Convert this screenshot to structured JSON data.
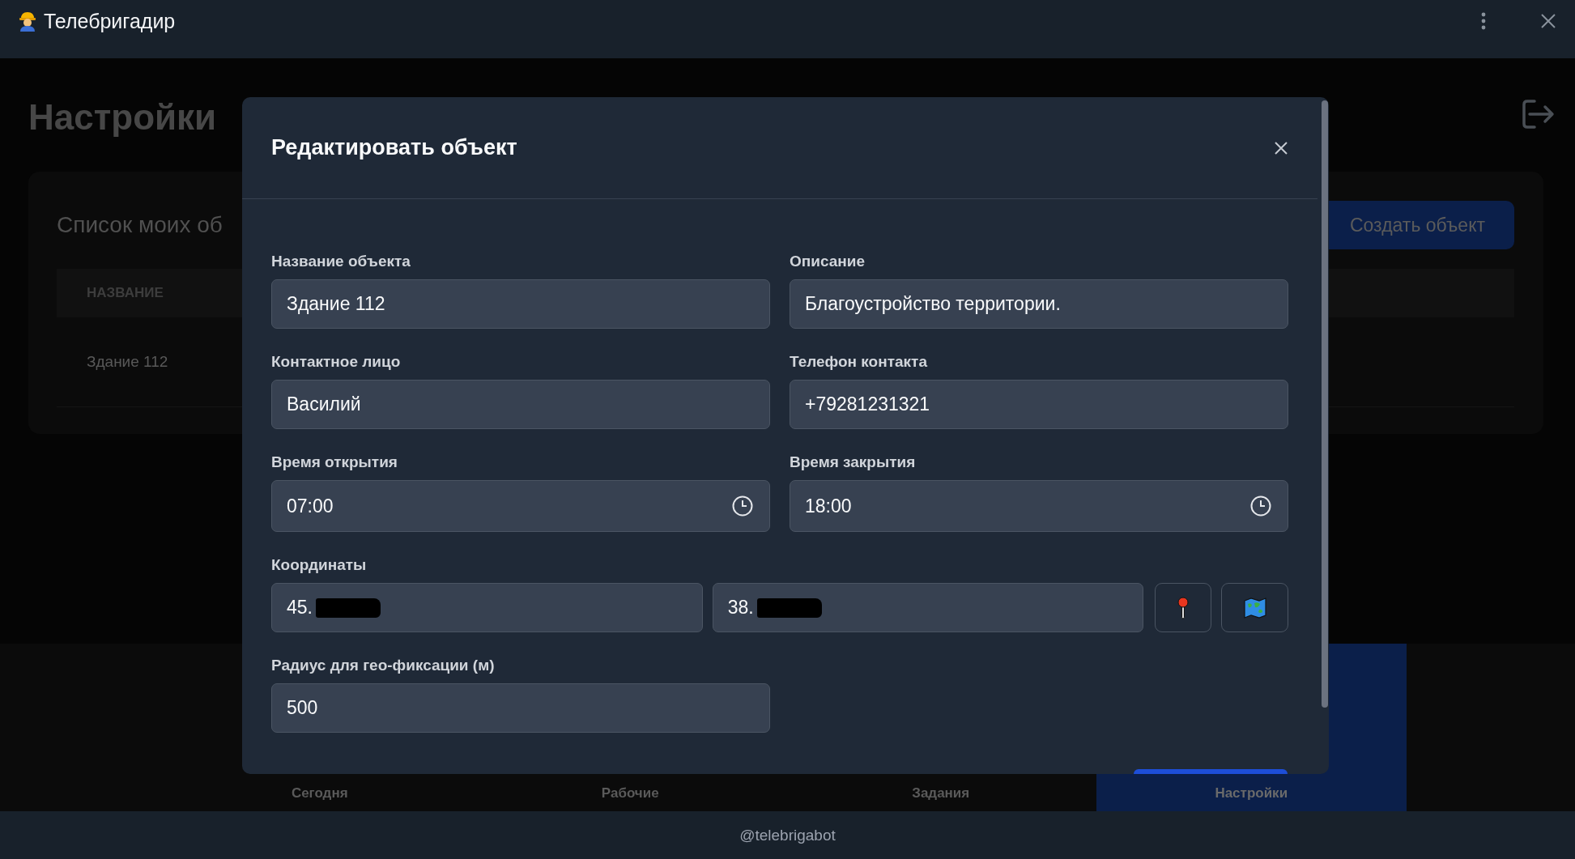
{
  "app_bar": {
    "title": "Телебригадир"
  },
  "page": {
    "title": "Настройки",
    "card": {
      "title": "Список моих об",
      "create_button": "Создать объект",
      "columns": [
        "НАЗВАНИЕ"
      ],
      "rows": [
        [
          "Здание 112"
        ]
      ]
    }
  },
  "bottom_nav": [
    {
      "label": "Сегодня",
      "selected": false
    },
    {
      "label": "Рабочие",
      "selected": false
    },
    {
      "label": "Задания",
      "selected": false
    },
    {
      "label": "Настройки",
      "selected": true
    }
  ],
  "modal": {
    "title": "Редактировать объект",
    "fields": [
      {
        "kind": "text",
        "label": "Название объекта",
        "value": "Здание 112"
      },
      {
        "kind": "text",
        "label": "Описание",
        "value": "Благоустройство территории."
      },
      {
        "kind": "text",
        "label": "Контактное лицо",
        "value": "Василий"
      },
      {
        "kind": "text",
        "label": "Телефон контакта",
        "value": "+79281231321"
      },
      {
        "kind": "time",
        "label": "Время открытия",
        "value": "07:00"
      },
      {
        "kind": "time",
        "label": "Время закрытия",
        "value": "18:00"
      },
      {
        "kind": "coords",
        "label": "Координаты",
        "values": [
          "45.",
          "38."
        ]
      },
      {
        "kind": "text",
        "label": "Радиус для гео-фиксации (м)",
        "value": "500"
      }
    ]
  },
  "footer": "@telebrigabot"
}
